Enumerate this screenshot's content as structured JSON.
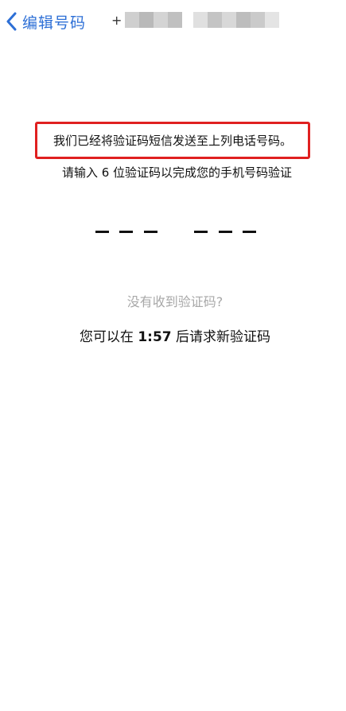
{
  "nav": {
    "back_label": "编辑号码",
    "phone_prefix": "+",
    "blur_colors": [
      "#cfcfcf",
      "#b9b9b9",
      "#d4d4d4",
      "#c0c0c0",
      "#e0e0e0",
      "#c4c4c4",
      "#d8d8d8",
      "#bdbdbd",
      "#cacaca",
      "#e4e4e4"
    ]
  },
  "message": {
    "headline": "我们已经将验证码短信发送至上列电话号码。",
    "instruction": "请输入 6 位验证码以完成您的手机号码验证",
    "highlight_color": "#e02020"
  },
  "code_input": {
    "digits": 6
  },
  "resend": {
    "no_code": "没有收到验证码?",
    "prefix": "您可以在 ",
    "timer": "1:57",
    "suffix": " 后请求新验证码"
  },
  "colors": {
    "accent": "#2d6fd6",
    "muted": "#a8a8a8"
  }
}
